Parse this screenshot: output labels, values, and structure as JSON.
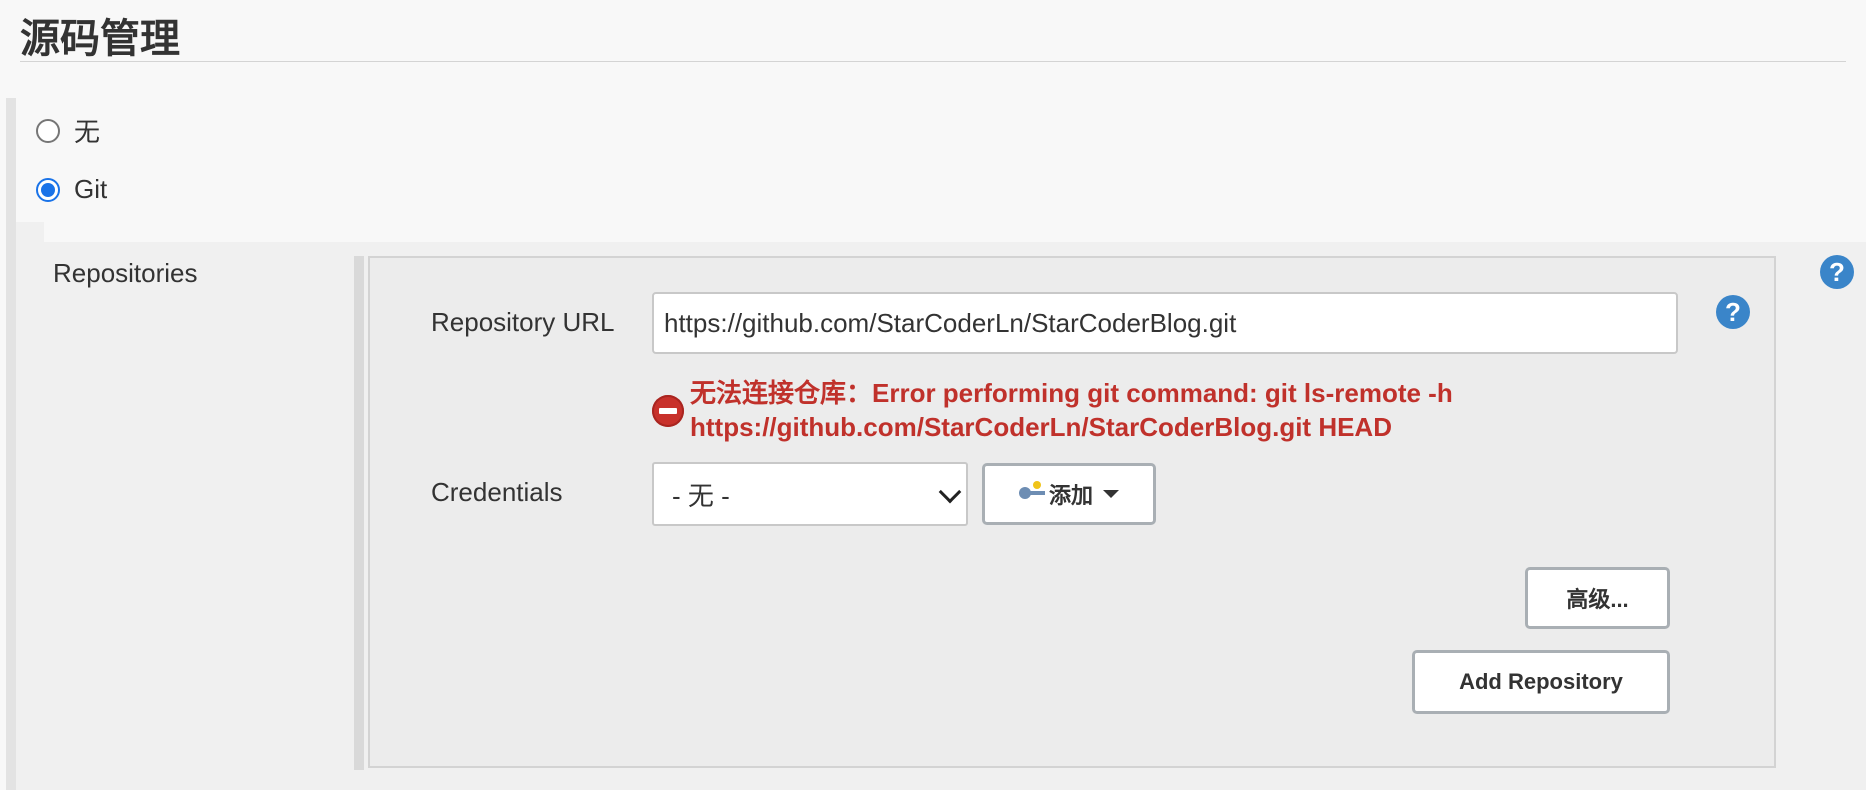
{
  "section": {
    "title": "源码管理"
  },
  "scm_options": [
    {
      "label": "无",
      "selected": false
    },
    {
      "label": "Git",
      "selected": true
    }
  ],
  "git": {
    "repositories_label": "Repositories",
    "repository_url_label": "Repository URL",
    "repository_url_value": "https://github.com/StarCoderLn/StarCoderBlog.git",
    "error_line1": "无法连接仓库：Error performing git command: git ls-remote -h",
    "error_line2": "https://github.com/StarCoderLn/StarCoderBlog.git HEAD",
    "credentials_label": "Credentials",
    "credentials_selected": "- 无 -",
    "add_button_label": "添加",
    "advanced_button_label": "高级...",
    "add_repository_button_label": "Add Repository",
    "help_icon_glyph": "?"
  },
  "colors": {
    "error": "#c0312b",
    "help_icon": "#3a85c9",
    "radio_selected": "#1a73e8"
  }
}
